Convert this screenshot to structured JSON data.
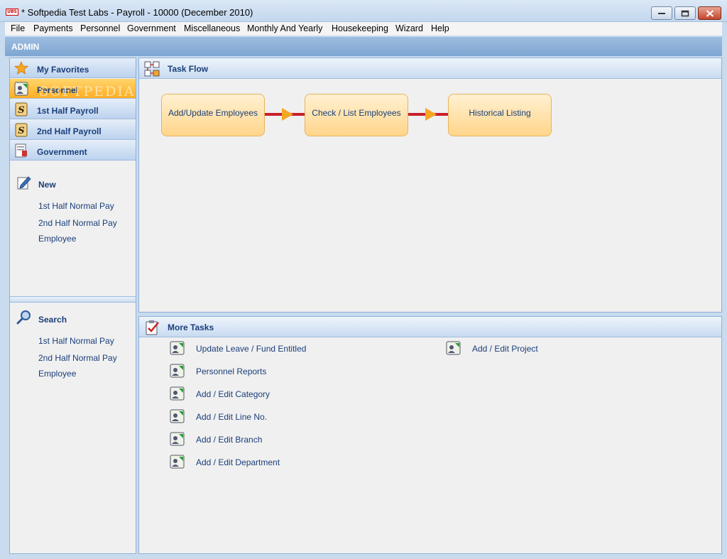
{
  "window": {
    "title": "* Softpedia Test Labs - Payroll - 10000 (December 2010)",
    "app_icon_text": "UBS"
  },
  "menu": [
    "File",
    "Payments",
    "Personnel",
    "Government",
    "Miscellaneous",
    "Monthly And Yearly",
    "Housekeeping",
    "Wizard",
    "Help"
  ],
  "user_bar": {
    "label": "ADMIN"
  },
  "sidebar": {
    "items": [
      {
        "label": "My Favorites",
        "icon": "star-icon",
        "active": false
      },
      {
        "label": "Personnel",
        "icon": "personnel-icon",
        "active": true
      },
      {
        "label": "1st  Half Payroll",
        "icon": "dollar-icon",
        "active": false
      },
      {
        "label": "2nd Half Payroll",
        "icon": "dollar-icon",
        "active": false
      },
      {
        "label": "Government",
        "icon": "government-icon",
        "active": false
      }
    ],
    "new_section": {
      "title": "New",
      "links": [
        "1st  Half Normal Pay",
        "2nd Half Normal Pay",
        "Employee"
      ]
    },
    "search_section": {
      "title": "Search",
      "links": [
        "1st  Half Normal Pay",
        "2nd Half Normal Pay",
        "Employee"
      ]
    }
  },
  "task_flow": {
    "title": "Task Flow",
    "steps": [
      "Add/Update Employees",
      "Check / List Employees",
      "Historical Listing"
    ]
  },
  "more_tasks": {
    "title": "More Tasks",
    "left": [
      "Update Leave / Fund Entitled",
      "Personnel Reports",
      "Add / Edit Category",
      "Add / Edit Line No.",
      "Add / Edit Branch",
      "Add / Edit Department"
    ],
    "right": [
      "Add / Edit Project"
    ]
  },
  "watermark": "SOFTPEDIA",
  "colors": {
    "accent": "#1a3e7a",
    "active_nav": "#ffae22",
    "flow_line": "#c8202a",
    "flow_arrow": "#f5a623"
  }
}
